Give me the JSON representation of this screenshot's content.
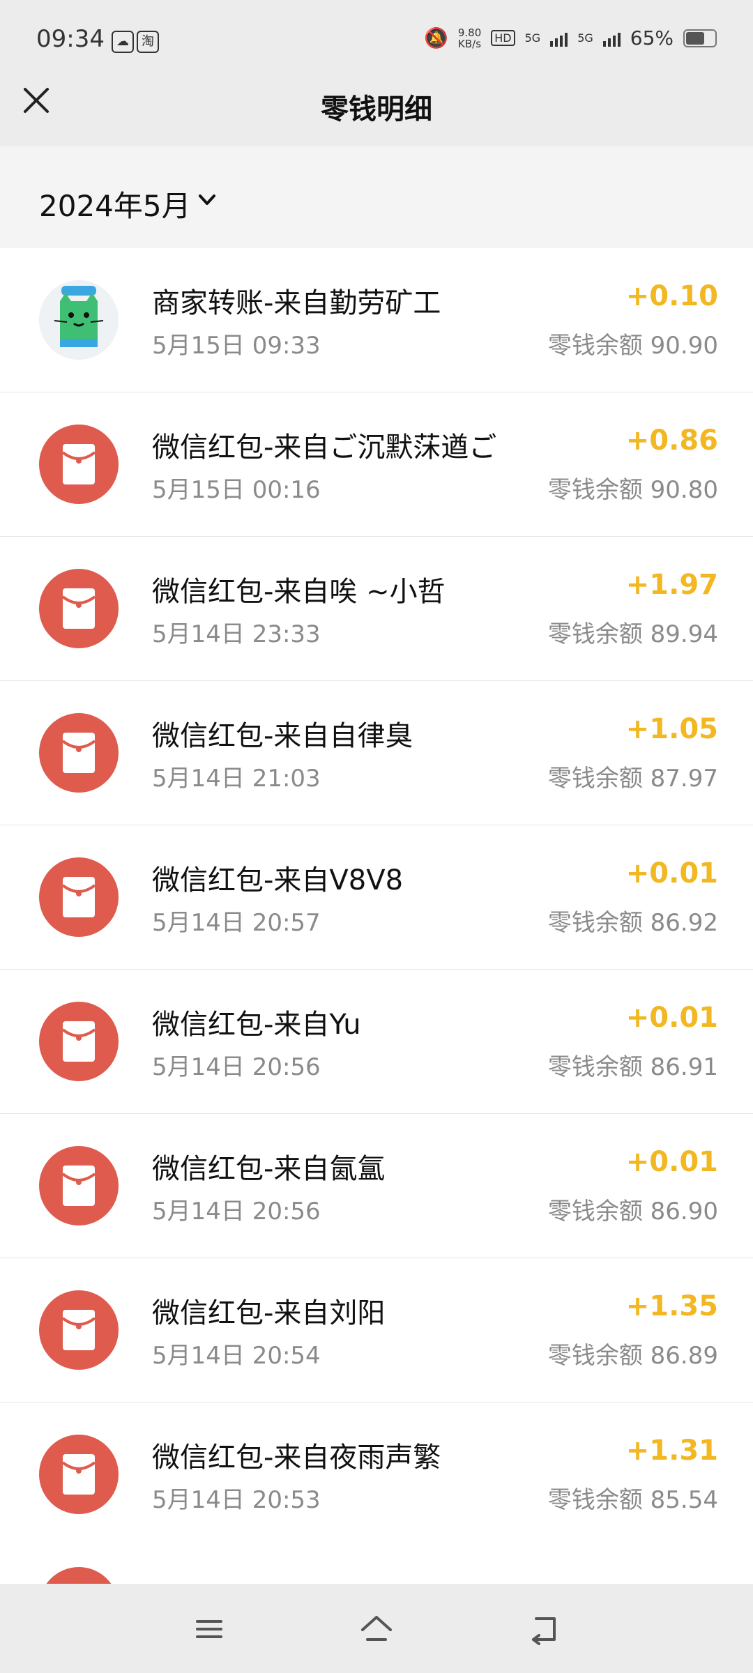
{
  "status_bar": {
    "time": "09:34",
    "app_icon_1": "cloud-app-icon",
    "app_icon_2_label": "淘",
    "net_speed": "9.80",
    "net_speed_unit": "KB/s",
    "hd_label": "HD",
    "sim1": "5G",
    "sim2": "5G",
    "battery": "65%"
  },
  "header": {
    "close_icon": "close-icon",
    "title": "零钱明细"
  },
  "filter": {
    "month": "2024年5月",
    "chevron_icon": "chevron-down-icon"
  },
  "transactions": [
    {
      "title": "商家转账-来自勤劳矿工",
      "time": "5月15日 09:33",
      "amount": "+0.10",
      "balance": "零钱余额 90.90",
      "avatar": "merchant-cat-avatar"
    },
    {
      "title": "微信红包-来自ご沉默莯遒ご",
      "time": "5月15日 00:16",
      "amount": "+0.86",
      "balance": "零钱余额 90.80",
      "avatar": "red-envelope-icon"
    },
    {
      "title": "微信红包-来自唉 ~小哲",
      "time": "5月14日 23:33",
      "amount": "+1.97",
      "balance": "零钱余额 89.94",
      "avatar": "red-envelope-icon"
    },
    {
      "title": "微信红包-来自自律臭",
      "time": "5月14日 21:03",
      "amount": "+1.05",
      "balance": "零钱余额 87.97",
      "avatar": "red-envelope-icon"
    },
    {
      "title": "微信红包-来自V8V8",
      "time": "5月14日 20:57",
      "amount": "+0.01",
      "balance": "零钱余额 86.92",
      "avatar": "red-envelope-icon"
    },
    {
      "title": "微信红包-来自Yu",
      "time": "5月14日 20:56",
      "amount": "+0.01",
      "balance": "零钱余额 86.91",
      "avatar": "red-envelope-icon"
    },
    {
      "title": "微信红包-来自氤氲",
      "time": "5月14日 20:56",
      "amount": "+0.01",
      "balance": "零钱余额 86.90",
      "avatar": "red-envelope-icon"
    },
    {
      "title": "微信红包-来自刘阳",
      "time": "5月14日 20:54",
      "amount": "+1.35",
      "balance": "零钱余额 86.89",
      "avatar": "red-envelope-icon"
    },
    {
      "title": "微信红包-来自夜雨声繁",
      "time": "5月14日 20:53",
      "amount": "+1.31",
      "balance": "零钱余额 85.54",
      "avatar": "red-envelope-icon"
    }
  ],
  "nav_bar": {
    "menu_icon": "menu-icon",
    "home_icon": "home-icon",
    "back_icon": "back-icon"
  },
  "colors": {
    "amount": "#f2b721",
    "red_envelope": "#de5b4e",
    "header_bg": "#ececec"
  }
}
